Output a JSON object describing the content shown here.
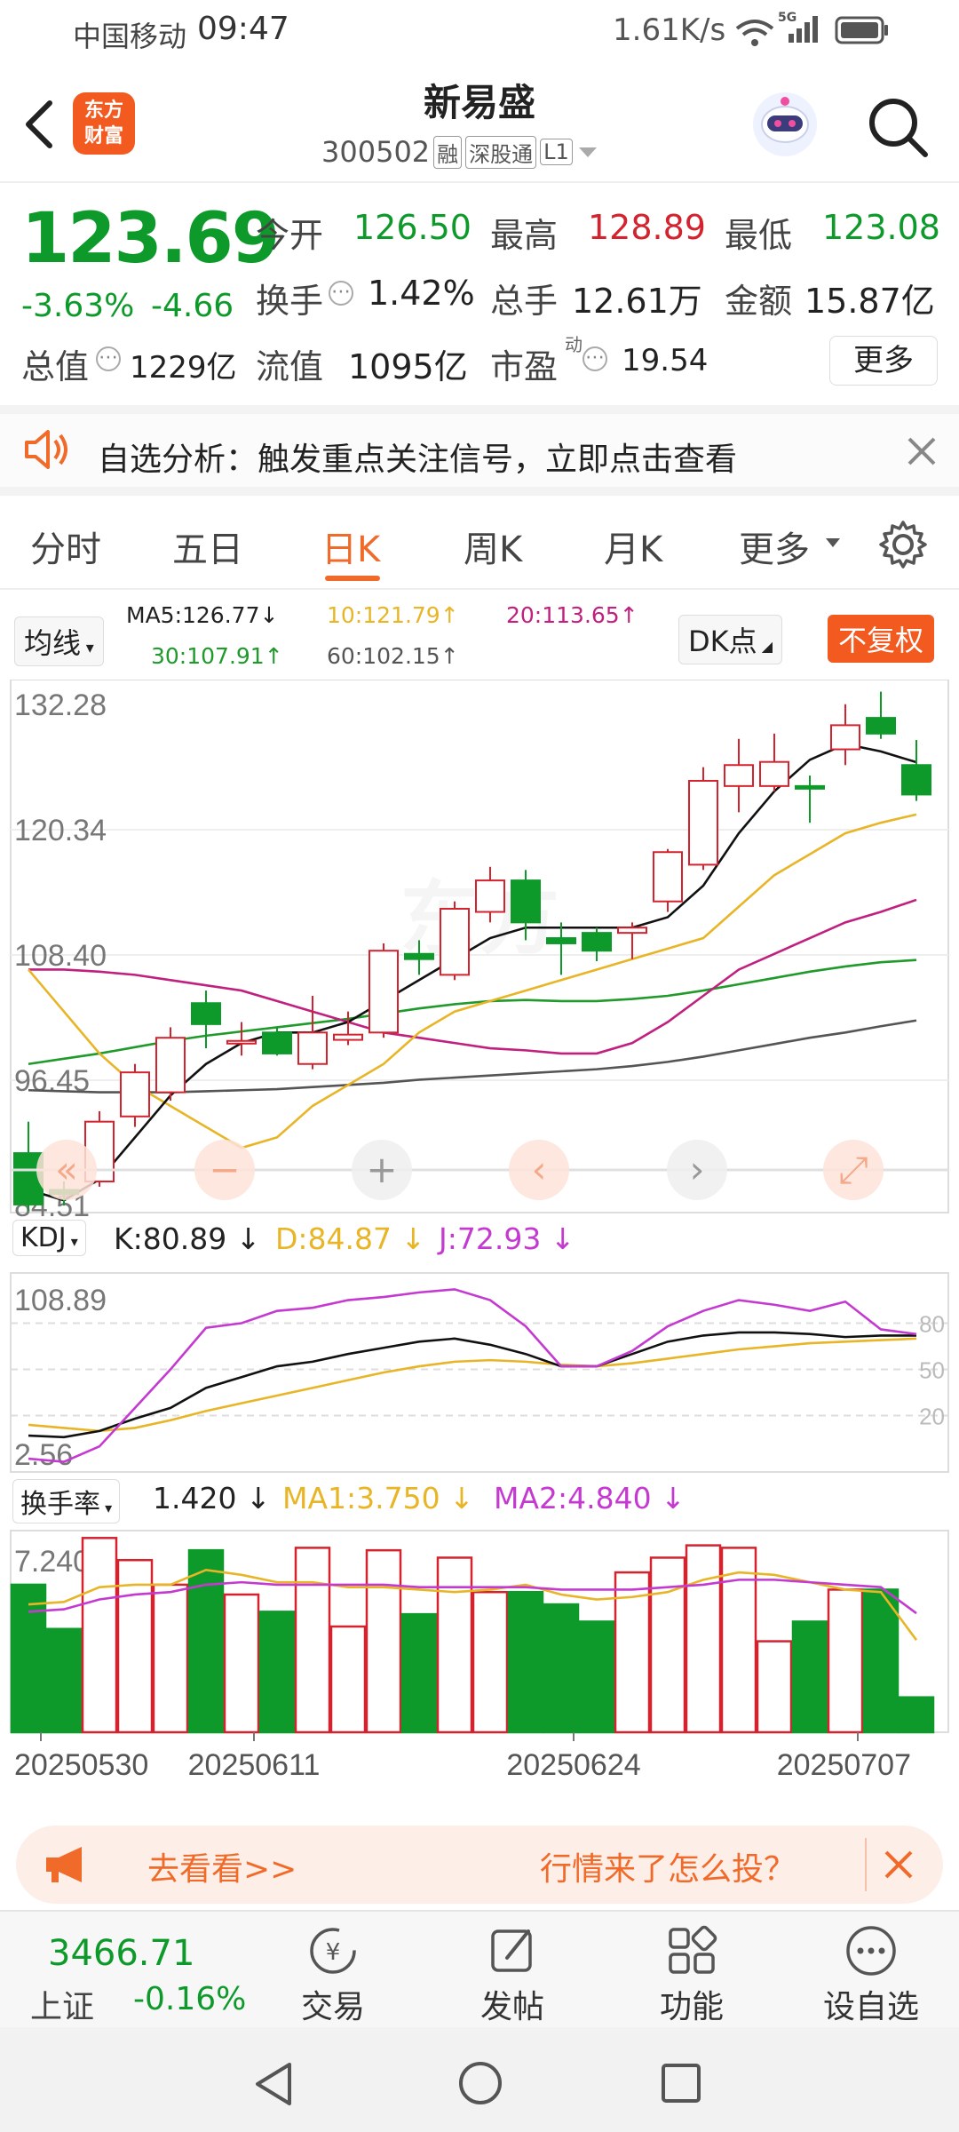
{
  "status_bar": {
    "carrier": "中国移动",
    "time": "09:47",
    "speed": "1.61K/s",
    "signal": "5G"
  },
  "header": {
    "logo_text_line1": "东方",
    "logo_text_line2": "财富",
    "stock_name": "新易盛",
    "stock_code": "300502",
    "tag_margin": "融",
    "tag_connect": "深股通",
    "tag_level": "L1"
  },
  "quote": {
    "price": "123.69",
    "change_pct": "-3.63%",
    "change_amt": "-4.66",
    "open_label": "今开",
    "open": "126.50",
    "high_label": "最高",
    "high": "128.89",
    "low_label": "最低",
    "low": "123.08",
    "turnover_label": "换手",
    "turnover": "1.42%",
    "volume_label": "总手",
    "volume": "12.61万",
    "amount_label": "金额",
    "amount": "15.87亿",
    "mktcap_label": "总值",
    "mktcap": "1229亿",
    "float_label": "流值",
    "float": "1095亿",
    "pe_label": "市盈",
    "pe_sup": "动",
    "pe": "19.54",
    "more_button": "更多"
  },
  "notice": {
    "text": "自选分析：触发重点关注信号，立即点击查看"
  },
  "tabs": [
    {
      "label": "分时"
    },
    {
      "label": "五日"
    },
    {
      "label": "日K"
    },
    {
      "label": "周K"
    },
    {
      "label": "月K"
    },
    {
      "label": "更多"
    }
  ],
  "ma_bar": {
    "selector": "均线",
    "ma5": "MA5:126.77",
    "ma10": "10:121.79",
    "ma20": "20:113.65",
    "ma30": "30:107.91",
    "ma60": "60:102.15",
    "dk_button": "DK点",
    "fq_button": "不复权"
  },
  "kdj": {
    "selector": "KDJ",
    "k": "K:80.89",
    "d": "D:84.87",
    "j": "J:72.93",
    "top": "108.89",
    "bottom": "2.56",
    "levels": [
      "80",
      "50",
      "20"
    ]
  },
  "turnover_panel": {
    "selector": "换手率",
    "value": "1.420",
    "ma1": "MA1:3.750",
    "ma2": "MA2:4.840",
    "top": "7.240"
  },
  "colors": {
    "up": "#d2232f",
    "down": "#0e9a2b",
    "ma5": "#111111",
    "ma10": "#e8b527",
    "ma20": "#c0207e",
    "ma30": "#1f9a2b",
    "ma60": "#555555",
    "accent": "#f06a2a"
  },
  "chart_data": {
    "type": "candlestick",
    "price_axis_labels": [
      "132.28",
      "120.34",
      "108.40",
      "96.45",
      "84.51"
    ],
    "ylim": [
      84.51,
      132.28
    ],
    "date_labels": [
      "20250530",
      "20250611",
      "20250624",
      "20250707"
    ],
    "candles": [
      {
        "o": 89.5,
        "h": 92.5,
        "l": 84.0,
        "c": 84.6
      },
      {
        "o": 86.0,
        "h": 86.8,
        "l": 84.5,
        "c": 85.6
      },
      {
        "o": 86.8,
        "h": 93.5,
        "l": 86.3,
        "c": 92.5
      },
      {
        "o": 93.0,
        "h": 98.0,
        "l": 92.0,
        "c": 97.2
      },
      {
        "o": 95.3,
        "h": 101.5,
        "l": 94.5,
        "c": 100.5
      },
      {
        "o": 103.8,
        "h": 105.0,
        "l": 99.5,
        "c": 101.8
      },
      {
        "o": 100.0,
        "h": 102.0,
        "l": 98.8,
        "c": 100.2
      },
      {
        "o": 101.0,
        "h": 101.5,
        "l": 98.8,
        "c": 99.0
      },
      {
        "o": 98.0,
        "h": 104.5,
        "l": 97.5,
        "c": 101.0
      },
      {
        "o": 100.3,
        "h": 103.0,
        "l": 99.8,
        "c": 100.8
      },
      {
        "o": 101.0,
        "h": 109.5,
        "l": 100.5,
        "c": 108.8
      },
      {
        "o": 108.5,
        "h": 109.8,
        "l": 106.5,
        "c": 108.0
      },
      {
        "o": 106.5,
        "h": 113.5,
        "l": 106.0,
        "c": 112.8
      },
      {
        "o": 112.5,
        "h": 116.8,
        "l": 111.5,
        "c": 115.5
      },
      {
        "o": 115.5,
        "h": 116.5,
        "l": 109.8,
        "c": 111.5
      },
      {
        "o": 110.0,
        "h": 111.5,
        "l": 106.5,
        "c": 109.5
      },
      {
        "o": 110.5,
        "h": 111.0,
        "l": 107.8,
        "c": 108.8
      },
      {
        "o": 110.5,
        "h": 111.5,
        "l": 108.0,
        "c": 111.0
      },
      {
        "o": 113.5,
        "h": 118.5,
        "l": 112.5,
        "c": 118.2
      },
      {
        "o": 117.0,
        "h": 126.3,
        "l": 116.5,
        "c": 125.0
      },
      {
        "o": 124.5,
        "h": 129.0,
        "l": 122.0,
        "c": 126.5
      },
      {
        "o": 124.5,
        "h": 129.5,
        "l": 124.0,
        "c": 126.8
      },
      {
        "o": 124.5,
        "h": 125.5,
        "l": 121.0,
        "c": 124.3
      },
      {
        "o": 128.0,
        "h": 132.3,
        "l": 126.5,
        "c": 130.3
      },
      {
        "o": 131.0,
        "h": 133.5,
        "l": 129.0,
        "c": 129.5
      },
      {
        "o": 126.5,
        "h": 128.89,
        "l": 123.08,
        "c": 123.69
      }
    ],
    "ma5": [
      86,
      85,
      87,
      91,
      95,
      98,
      100,
      101,
      101,
      102,
      104,
      106,
      108,
      110,
      111,
      111,
      111,
      111,
      112,
      115,
      120,
      124,
      127,
      128.5,
      127.8,
      126.77
    ],
    "ma10": [
      107,
      103,
      99,
      96,
      94,
      92,
      90,
      91,
      94,
      96,
      98,
      101,
      103,
      104,
      105,
      106,
      107,
      108,
      109,
      110,
      113,
      116,
      118,
      120,
      121,
      121.79
    ],
    "ma20": [
      107,
      107,
      106.8,
      106.5,
      106,
      105.5,
      105,
      104,
      103,
      102,
      101,
      100.5,
      100,
      99.5,
      99.3,
      99,
      99,
      100,
      102,
      104.5,
      107,
      108.5,
      110,
      111.5,
      112.5,
      113.65
    ],
    "ma30": [
      98,
      98.5,
      99,
      99.6,
      100.2,
      100.7,
      101.1,
      101.5,
      101.9,
      102.3,
      102.8,
      103.3,
      103.7,
      104,
      104.1,
      104,
      104,
      104.2,
      104.5,
      105,
      105.6,
      106.2,
      106.8,
      107.3,
      107.7,
      107.91
    ],
    "ma60": [
      95.5,
      95.4,
      95.3,
      95.3,
      95.3,
      95.4,
      95.5,
      95.6,
      95.8,
      96,
      96.2,
      96.5,
      96.7,
      96.9,
      97.1,
      97.3,
      97.5,
      97.8,
      98.2,
      98.7,
      99.3,
      99.9,
      100.5,
      101,
      101.6,
      102.15
    ],
    "kdj_k": [
      7,
      6,
      10,
      18,
      25,
      38,
      45,
      52,
      55,
      60,
      64,
      68,
      70,
      66,
      60,
      52,
      52,
      60,
      68,
      72,
      74,
      74,
      73,
      71,
      72,
      72
    ],
    "kdj_d": [
      14,
      12,
      10,
      12,
      17,
      23,
      28,
      33,
      38,
      43,
      48,
      52,
      55,
      56,
      55,
      53,
      52,
      54,
      57,
      60,
      63,
      65,
      67,
      68,
      69,
      70
    ],
    "kdj_j": [
      -8,
      -10,
      0,
      25,
      50,
      77,
      80,
      88,
      90,
      95,
      97,
      100,
      102,
      95,
      78,
      52,
      52,
      62,
      78,
      88,
      95,
      92,
      88,
      94,
      76,
      72.93
    ],
    "turnover": [
      6.0,
      4.2,
      7.9,
      7.0,
      6.0,
      7.4,
      5.6,
      4.9,
      7.5,
      4.3,
      7.4,
      4.8,
      7.1,
      5.7,
      5.7,
      5.2,
      4.5,
      6.5,
      7.1,
      7.6,
      7.5,
      3.7,
      4.5,
      5.8,
      5.8,
      1.42
    ],
    "turnover_ma1": [
      5.2,
      5.3,
      5.9,
      6.0,
      6.0,
      6.6,
      6.4,
      6.1,
      6.1,
      5.9,
      5.9,
      5.8,
      5.7,
      5.8,
      6.0,
      5.6,
      5.4,
      5.5,
      5.7,
      6.2,
      6.5,
      6.4,
      6.1,
      5.8,
      5.7,
      3.75
    ],
    "turnover_ma2": [
      4.9,
      5.0,
      5.4,
      5.6,
      5.7,
      6.0,
      6.1,
      6.0,
      6.0,
      6.0,
      6.0,
      5.9,
      5.9,
      5.9,
      5.9,
      5.8,
      5.8,
      5.8,
      5.9,
      6.0,
      6.2,
      6.2,
      6.1,
      6.0,
      5.9,
      4.84
    ]
  },
  "promo": {
    "left": "去看看>>",
    "right": "行情来了怎么投？"
  },
  "bottom_nav": {
    "index_value": "3466.71",
    "index_name": "上证",
    "index_change": "-0.16%",
    "items": [
      {
        "label": "交易"
      },
      {
        "label": "发帖"
      },
      {
        "label": "功能"
      },
      {
        "label": "设自选"
      }
    ]
  }
}
